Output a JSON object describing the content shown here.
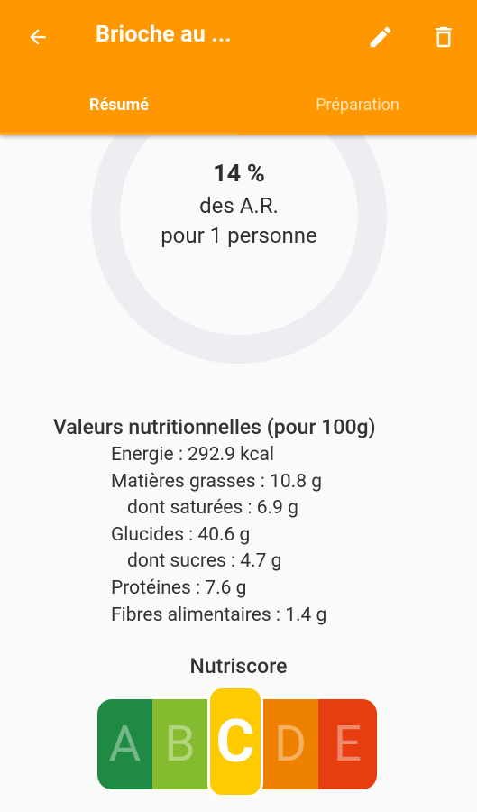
{
  "app_bar": {
    "title": "Brioche au ...",
    "back_icon": "arrow-back-icon",
    "edit_icon": "pencil-icon",
    "delete_icon": "trash-icon",
    "color": "#ff9800"
  },
  "tabs": [
    {
      "label": "Résumé",
      "selected": true
    },
    {
      "label": "Préparation",
      "selected": false
    }
  ],
  "summary": {
    "percent": "14 %",
    "line1": "des A.R.",
    "line2": "pour 1 personne",
    "ring_fraction": 0.14
  },
  "nutrition": {
    "title": "Valeurs nutritionnelles (pour 100g)",
    "rows": [
      {
        "text": "Energie : 292.9 kcal",
        "indent": false
      },
      {
        "text": "Matières grasses : 10.8 g",
        "indent": false
      },
      {
        "text": "dont saturées : 6.9 g",
        "indent": true
      },
      {
        "text": "Glucides : 40.6 g",
        "indent": false
      },
      {
        "text": "dont sucres : 4.7 g",
        "indent": true
      },
      {
        "text": "Protéines : 7.6 g",
        "indent": false
      },
      {
        "text": "Fibres alimentaires : 1.4 g",
        "indent": false
      }
    ]
  },
  "nutriscore": {
    "title": "Nutriscore",
    "grades": [
      "A",
      "B",
      "C",
      "D",
      "E"
    ],
    "selected": "C",
    "colors": {
      "A": "#1f8a43",
      "B": "#85bb2f",
      "C": "#fecb02",
      "D": "#ee8100",
      "E": "#e63e11"
    }
  }
}
